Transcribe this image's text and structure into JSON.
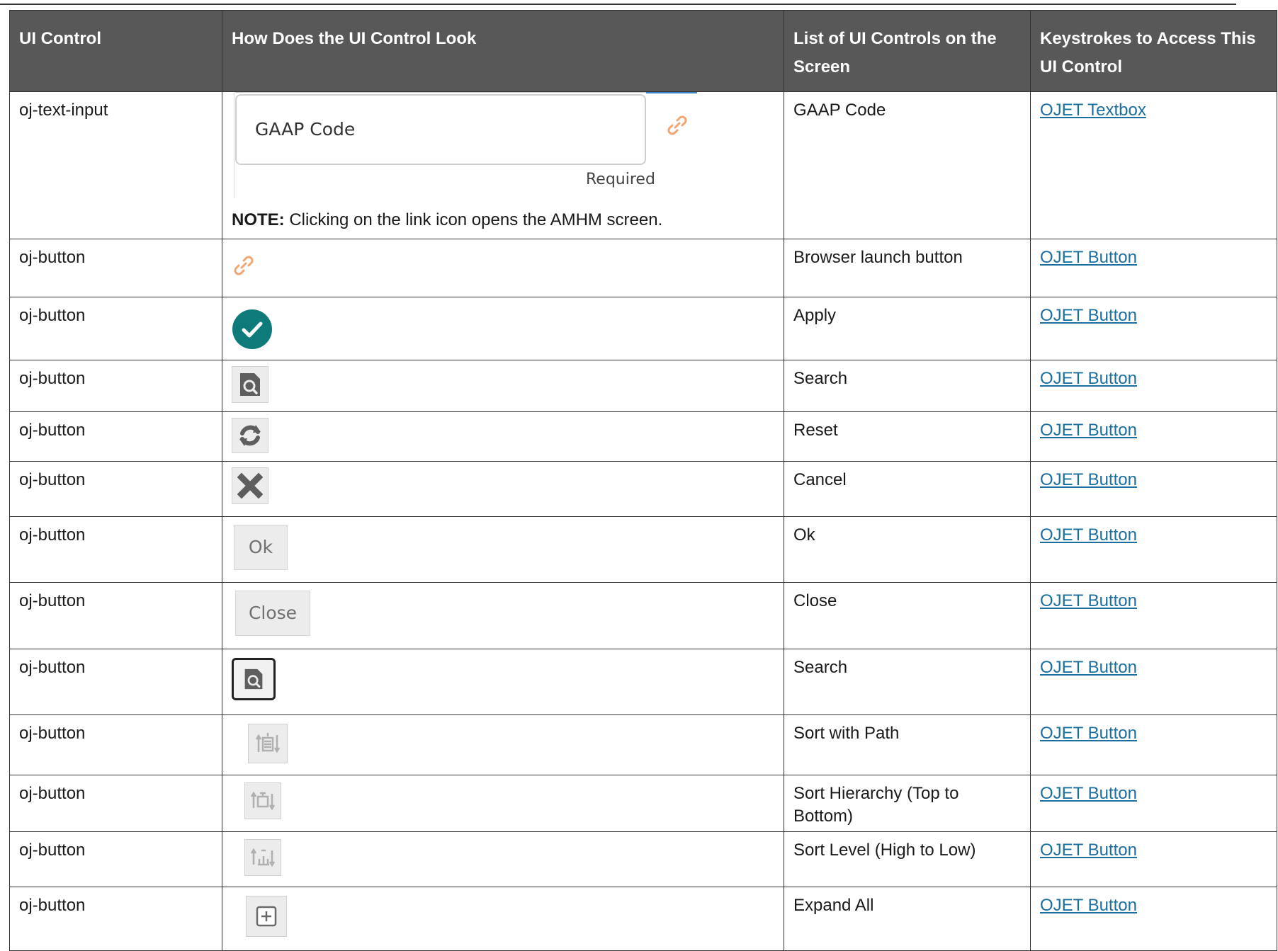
{
  "headers": {
    "col1": "UI Control",
    "col2": "How Does the UI Control Look",
    "col3": "List of UI Controls on the Screen",
    "col4": "Keystrokes to Access This UI Control"
  },
  "rows": [
    {
      "control": "oj-text-input",
      "label": "GAAP Code",
      "link": "OJET Textbox",
      "field_text": "GAAP Code",
      "required_text": "Required",
      "note_label": "NOTE:",
      "note_text": " Clicking on the link icon opens the AMHM screen."
    },
    {
      "control": "oj-button",
      "label": "Browser launch button",
      "link": "OJET Button",
      "icon": "link-icon"
    },
    {
      "control": "oj-button",
      "label": "Apply",
      "link": "OJET Button",
      "icon": "check-circle-icon"
    },
    {
      "control": "oj-button",
      "label": "Search",
      "link": "OJET Button",
      "icon": "search-doc-icon"
    },
    {
      "control": "oj-button",
      "label": "Reset",
      "link": "OJET Button",
      "icon": "refresh-icon"
    },
    {
      "control": "oj-button",
      "label": "Cancel",
      "link": "OJET Button",
      "icon": "close-x-icon"
    },
    {
      "control": "oj-button",
      "label": "Ok",
      "link": "OJET Button",
      "button_text": "Ok"
    },
    {
      "control": "oj-button",
      "label": "Close",
      "link": "OJET Button",
      "button_text": "Close"
    },
    {
      "control": "oj-button",
      "label": "Search",
      "link": "OJET Button",
      "icon": "search-doc-icon"
    },
    {
      "control": "oj-button",
      "label": "Sort with Path",
      "link": "OJET Button",
      "icon": "sort-path-icon"
    },
    {
      "control": "oj-button",
      "label": "Sort Hierarchy (Top to Bottom)",
      "link": "OJET Button",
      "icon": "sort-hierarchy-icon"
    },
    {
      "control": "oj-button",
      "label": "Sort Level (High to Low)",
      "link": "OJET Button",
      "icon": "sort-level-icon"
    },
    {
      "control": "oj-button",
      "label": "Expand All",
      "link": "OJET Button",
      "icon": "expand-all-icon"
    }
  ],
  "colors": {
    "header_bg": "#585858",
    "link": "#1a6fa0",
    "apply_teal": "#0e7a7a",
    "link_icon_orange": "#f0a572"
  }
}
